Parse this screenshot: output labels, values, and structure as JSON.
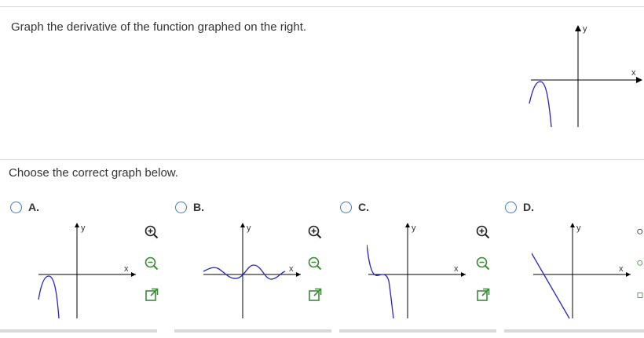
{
  "question": {
    "prompt": "Graph the derivative of the function graphed on the right.",
    "instruction": "Choose the correct graph below."
  },
  "axes": {
    "x_label": "x",
    "y_label": "y"
  },
  "options": [
    {
      "letter": "A.",
      "selected": false
    },
    {
      "letter": "B.",
      "selected": false
    },
    {
      "letter": "C.",
      "selected": false
    },
    {
      "letter": "D.",
      "selected": false
    }
  ],
  "tools": [
    "zoom-in-icon",
    "zoom-out-icon",
    "popout-icon"
  ],
  "colors": {
    "curve": "#2424c8",
    "radio": "#3a7bd5",
    "axis": "#000000"
  }
}
